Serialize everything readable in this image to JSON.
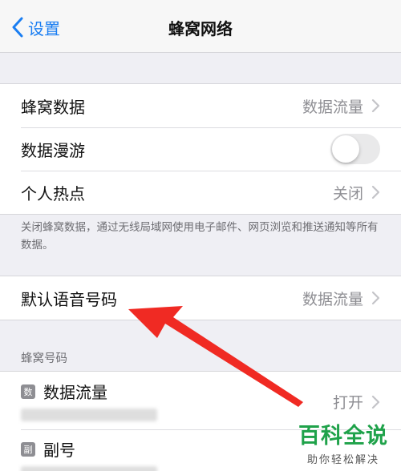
{
  "nav": {
    "back_label": "设置",
    "title": "蜂窝网络"
  },
  "group1": {
    "cellular_data_label": "蜂窝数据",
    "cellular_data_value": "数据流量",
    "roaming_label": "数据漫游",
    "roaming_on": false,
    "hotspot_label": "个人热点",
    "hotspot_value": "关闭"
  },
  "footnote": "关闭蜂窝数据，通过无线局域网使用电子邮件、网页浏览和推送通知等所有数据。",
  "group2": {
    "voice_label": "默认语音号码",
    "voice_value": "数据流量"
  },
  "section_header": "蜂窝号码",
  "sims": [
    {
      "badge": "数",
      "name": "数据流量",
      "value": "打开"
    },
    {
      "badge": "副",
      "name": "副号",
      "value": ""
    }
  ],
  "watermark": {
    "main": "百科全说",
    "sub": "助你轻松解决"
  },
  "colors": {
    "accent": "#1a7ef2",
    "arrow": "#f02a23",
    "watermark": "#1fa24a"
  }
}
